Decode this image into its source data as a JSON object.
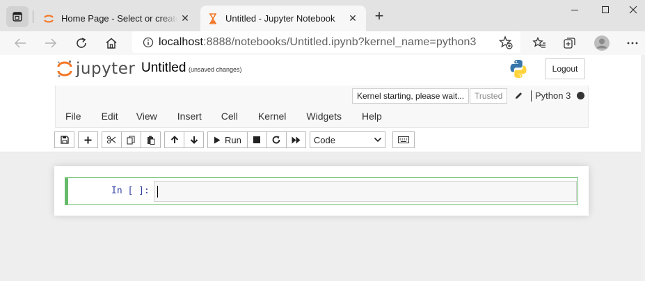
{
  "browser": {
    "tabs": [
      {
        "title": "Home Page - Select or create a notebook",
        "active": false,
        "favicon": "jupyter-favicon"
      },
      {
        "title": "Untitled - Jupyter Notebook",
        "active": true,
        "favicon": "hourglass-favicon"
      }
    ],
    "tab_close_glyph": "✕",
    "new_tab_glyph": "+",
    "url_host": "localhost",
    "url_rest": ":8888/notebooks/Untitled.ipynb?kernel_name=python3"
  },
  "jupyter": {
    "logo_text": "jupyter",
    "notebook_name": "Untitled",
    "save_state": "(unsaved changes)",
    "logout_label": "Logout",
    "kernel_status": "Kernel starting, please wait...",
    "trusted_label": "Trusted",
    "kernel_name": "Python 3",
    "menus": [
      "File",
      "Edit",
      "View",
      "Insert",
      "Cell",
      "Kernel",
      "Widgets",
      "Help"
    ],
    "run_label": "Run",
    "cell_type": "Code",
    "cell_prompt": "In [ ]:"
  },
  "colors": {
    "jupyter_orange": "#f37726",
    "cell_border": "#66bb6a",
    "prompt": "#303f9f"
  }
}
